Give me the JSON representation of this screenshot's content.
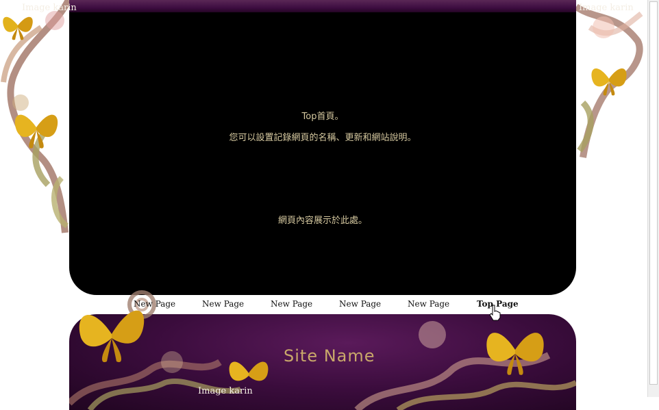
{
  "credits": {
    "top_left": "Image karin",
    "top_right": "Image karin",
    "bottom": "Image karin"
  },
  "content": {
    "heading": "Top首頁。",
    "description": "您可以設置記錄網頁的名稱、更新和網站說明。",
    "body": "網頁內容展示於此處。"
  },
  "nav": {
    "items": [
      "New Page",
      "New Page",
      "New Page",
      "New Page",
      "New Page",
      "Top Page"
    ],
    "active_index": 5
  },
  "banner": {
    "site_name": "Site Name"
  },
  "colors": {
    "panel": "#000000",
    "text": "#d6c9a0",
    "banner": "#3a0c3c",
    "gold": "#d9a520"
  },
  "icons": [
    "butterfly-icon",
    "swirl-ornament",
    "hand-pointer-icon"
  ]
}
